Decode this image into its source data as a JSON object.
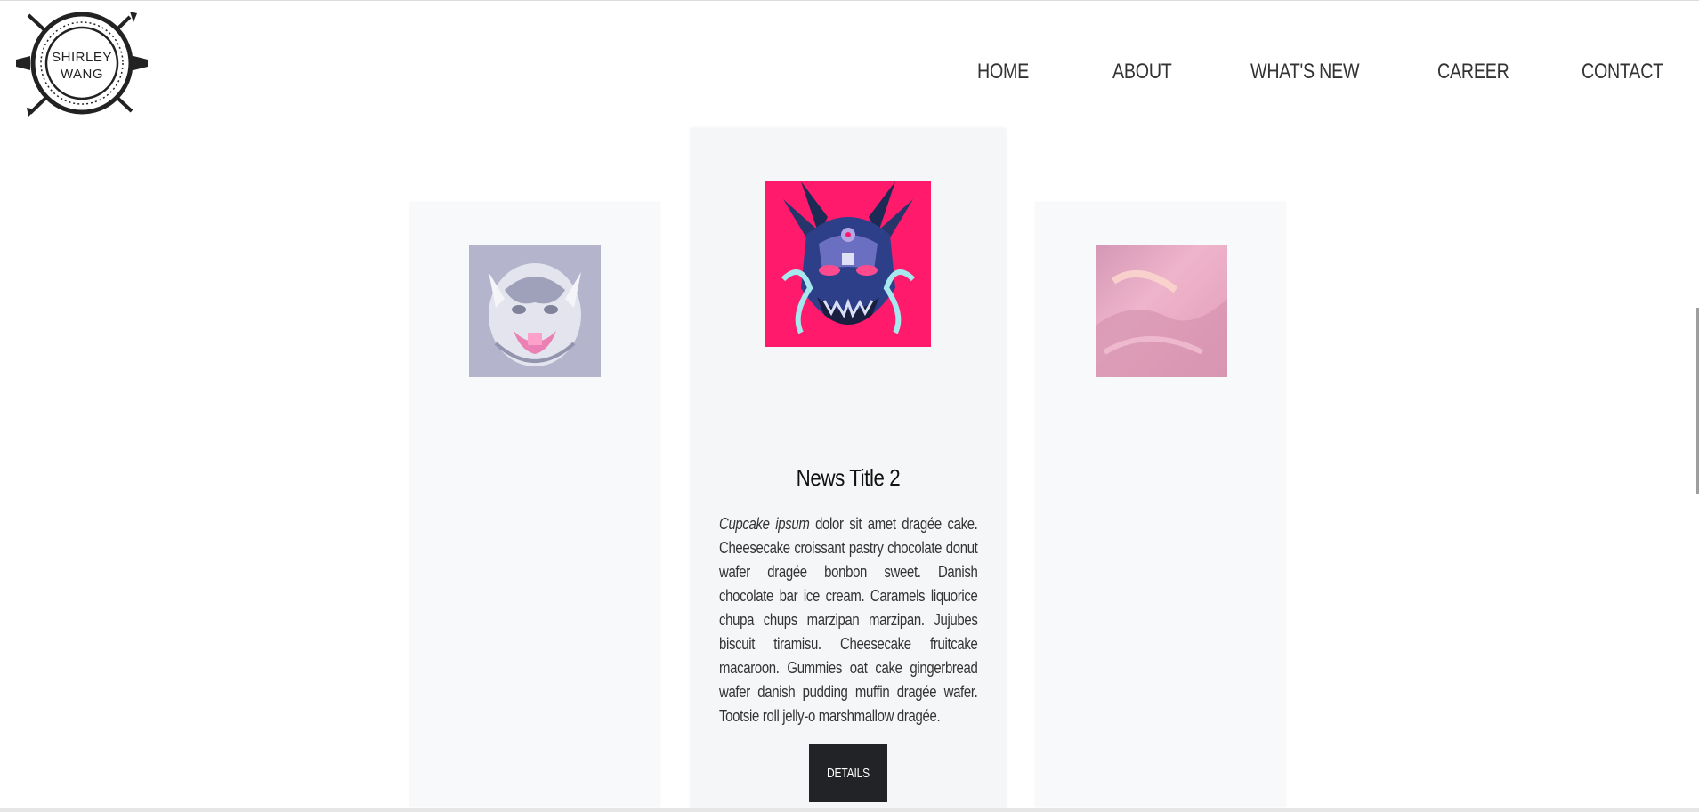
{
  "logo": {
    "line1": "SHIRLEY",
    "line2": "WANG",
    "icon": "arrows-circle-logo"
  },
  "nav": {
    "items": [
      {
        "label": "HOME"
      },
      {
        "label": "ABOUT"
      },
      {
        "label": "WHAT'S NEW"
      },
      {
        "label": "CAREER"
      },
      {
        "label": "CONTACT"
      }
    ]
  },
  "cards": {
    "left": {
      "image": "tiger-artwork-image"
    },
    "center": {
      "image": "oni-mask-artwork-image",
      "title": "News Title 2",
      "body_italic": "Cupcake ipsum",
      "body_rest": " dolor sit amet dragée cake. Cheesecake croissant pastry chocolate donut wafer dragée bonbon sweet. Danish chocolate bar ice cream. Caramels liquorice chupa chups marzipan marzipan. Jujubes biscuit tiramisu. Cheesecake fruitcake macaroon. Gummies oat cake gingerbread wafer danish pudding muffin dragée wafer. Tootsie roll jelly-o marshmallow dragée.",
      "button_label": "DETAILS"
    },
    "right": {
      "image": "pink-clouds-artwork-image"
    }
  },
  "colors": {
    "nav_text": "#333333",
    "card_bg": "#f7f8fa",
    "button_bg": "#212326",
    "accent_pink": "#ff1a6c"
  }
}
